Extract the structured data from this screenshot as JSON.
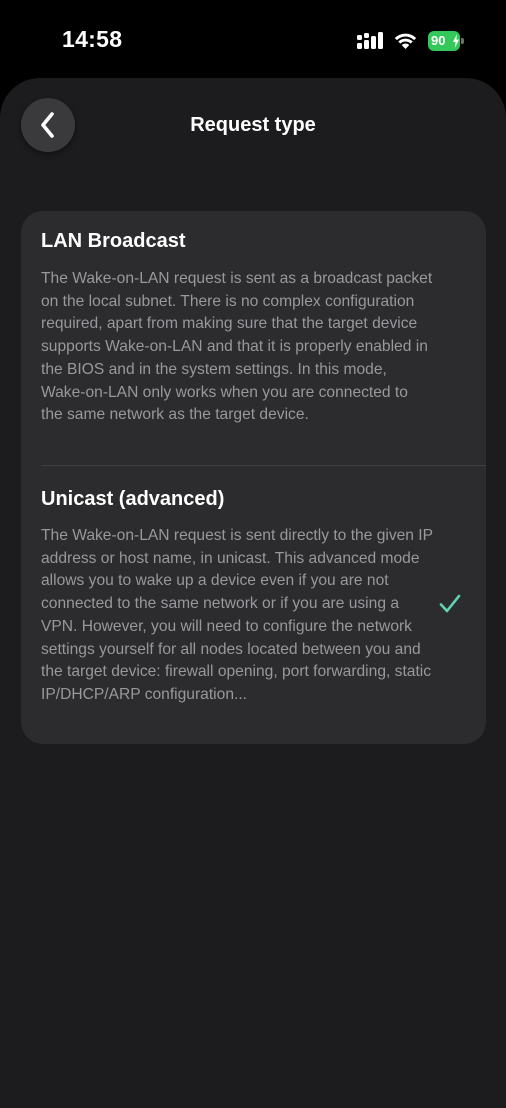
{
  "status_bar": {
    "time": "14:58",
    "battery_level": "90",
    "battery_color": "#34c759",
    "icons": [
      "signal-icon",
      "wifi-icon",
      "battery-icon",
      "charging-bolt-icon"
    ]
  },
  "nav": {
    "back_icon": "chevron-left-icon",
    "title": "Request type"
  },
  "options": [
    {
      "title": "LAN Broadcast",
      "description": "The Wake-on-LAN request is sent as a broadcast packet on the local subnet. There is no complex configuration required, apart from making sure that the target device supports Wake-on-LAN and that it is properly enabled in the BIOS and in the system settings. In this mode, Wake-on-LAN only works when you are connected to the same network as the target device.",
      "selected": false
    },
    {
      "title": "Unicast (advanced)",
      "description": "The Wake-on-LAN request is sent directly to the given IP address or host name, in unicast. This advanced mode allows you to wake up a device even if you are not connected to the same network or if you are using a VPN. However, you will need to configure the network settings yourself for all nodes located between you and the target device: firewall opening, port forwarding, static IP/DHCP/ARP configuration...",
      "selected": true
    }
  ],
  "colors": {
    "background": "#1c1c1e",
    "card": "#2c2c2e",
    "secondary_text": "#98989d",
    "checkmark": "#5fd4b4"
  }
}
